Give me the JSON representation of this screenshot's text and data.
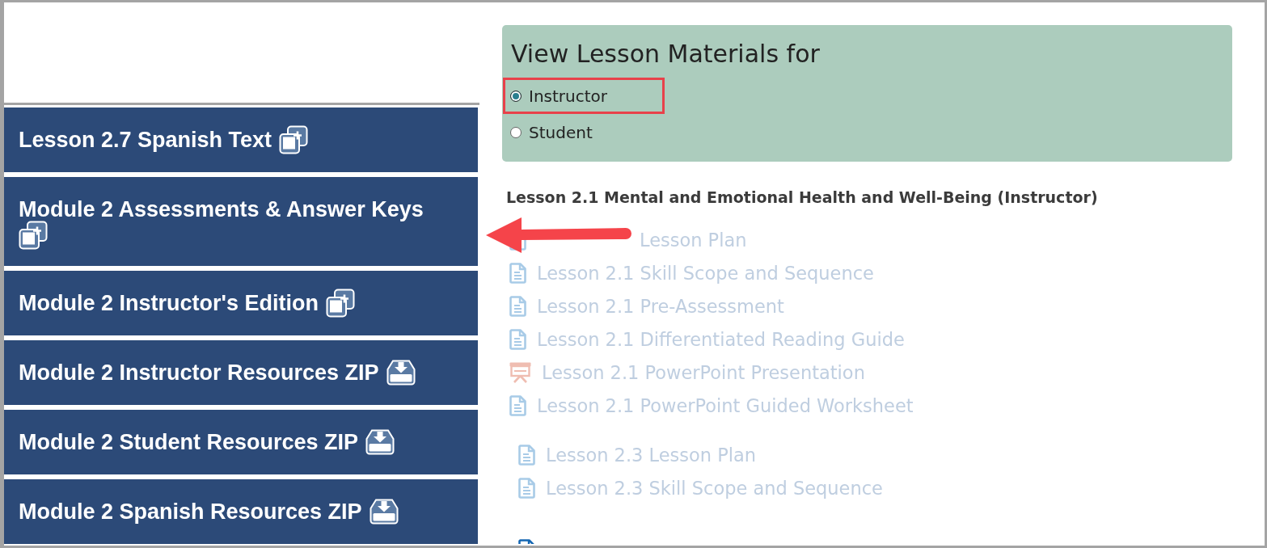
{
  "sidebar": {
    "items": [
      {
        "label": "Lesson 2.7 Spanish Text",
        "kind": "expand"
      },
      {
        "label": "Module 2 Assessments & Answer Keys",
        "kind": "expand"
      },
      {
        "label": "Module 2 Instructor's Edition",
        "kind": "expand"
      },
      {
        "label": "Module 2 Instructor Resources ZIP",
        "kind": "download"
      },
      {
        "label": "Module 2 Student Resources ZIP",
        "kind": "download"
      },
      {
        "label": "Module 2 Spanish Resources ZIP",
        "kind": "download"
      }
    ]
  },
  "materials_panel": {
    "title": "View Lesson Materials for",
    "options": [
      {
        "label": "Instructor",
        "selected": true,
        "highlighted": true
      },
      {
        "label": "Student",
        "selected": false,
        "highlighted": false
      }
    ]
  },
  "lesson": {
    "heading": "Lesson 2.1 Mental and Emotional Health and Well-Being (Instructor)",
    "groups": [
      {
        "items": [
          {
            "label": "Lesson Plan",
            "kind": "document",
            "faded": true
          },
          {
            "label": "Lesson 2.1 Skill Scope and Sequence",
            "kind": "document",
            "faded": true
          },
          {
            "label": "Lesson 2.1 Pre-Assessment",
            "kind": "document",
            "faded": true
          },
          {
            "label": "Lesson 2.1 Differentiated Reading Guide",
            "kind": "document",
            "faded": true
          },
          {
            "label": "Lesson 2.1 PowerPoint Presentation",
            "kind": "presentation",
            "faded": true
          },
          {
            "label": "Lesson 2.1 PowerPoint Guided Worksheet",
            "kind": "document",
            "faded": true
          }
        ]
      },
      {
        "items": [
          {
            "label": "Lesson 2.3 Lesson Plan",
            "kind": "document",
            "faded": true
          },
          {
            "label": "Lesson 2.3 Skill Scope and Sequence",
            "kind": "document",
            "faded": true
          }
        ]
      },
      {
        "items": [
          {
            "kind": "document",
            "faded": false
          }
        ]
      }
    ]
  }
}
